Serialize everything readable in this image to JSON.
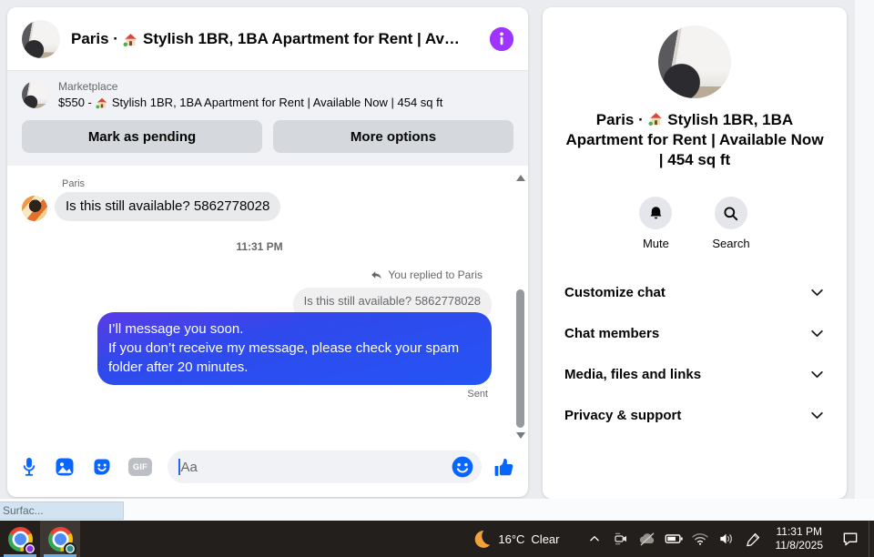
{
  "theme": {
    "accent_blue": "#0866ff",
    "info_purple": "#a033ff",
    "bubble_gradient_top": "#5a3be6",
    "bubble_gradient_bottom": "#2454f5",
    "incoming_bubble_gray": "#e9eaec",
    "card_bg": "#ffffff",
    "page_bg": "#eaecef",
    "taskbar_bg": "#231f1c",
    "taskbar_underline_blue": "#68aee4"
  },
  "chat_header": {
    "title_prefix": "Paris ·",
    "house_emoji": "🏡",
    "title_suffix": "Stylish 1BR, 1BA Apartment for Rent | Av…"
  },
  "marketplace": {
    "app_label": "Marketplace",
    "price_prefix": "$550 -",
    "listing_suffix": "Stylish 1BR, 1BA Apartment for Rent | Available Now | 454 sq ft",
    "primary_button": "Mark as pending",
    "secondary_button": "More options"
  },
  "conversation": {
    "sender_name": "Paris",
    "incoming_message": "Is this still available? 5862778028",
    "timestamp": "11:31 PM",
    "reply_context": "You replied to Paris",
    "quoted_message": "Is this still available? 5862778028",
    "outgoing_lines": [
      "I’ll message you soon.",
      "If you don’t receive my message, please check your spam folder after 20 minutes."
    ],
    "status": "Sent"
  },
  "composer": {
    "placeholder": "Aa",
    "gif_label": "GIF"
  },
  "details_panel": {
    "title_prefix": "Paris ·",
    "title_suffix": "Stylish 1BR, 1BA Apartment for Rent | Available Now | 454 sq ft",
    "actions": [
      {
        "label": "Mute",
        "icon": "bell-icon"
      },
      {
        "label": "Search",
        "icon": "search-icon"
      }
    ],
    "menu": [
      {
        "label": "Customize chat"
      },
      {
        "label": "Chat members"
      },
      {
        "label": "Media, files and links"
      },
      {
        "label": "Privacy & support"
      }
    ]
  },
  "browser": {
    "status_tooltip": "Surfac..."
  },
  "taskbar": {
    "weather_temp": "16°C",
    "weather_condition": "Clear",
    "time": "11:31 PM",
    "date": "11/8/2025"
  }
}
